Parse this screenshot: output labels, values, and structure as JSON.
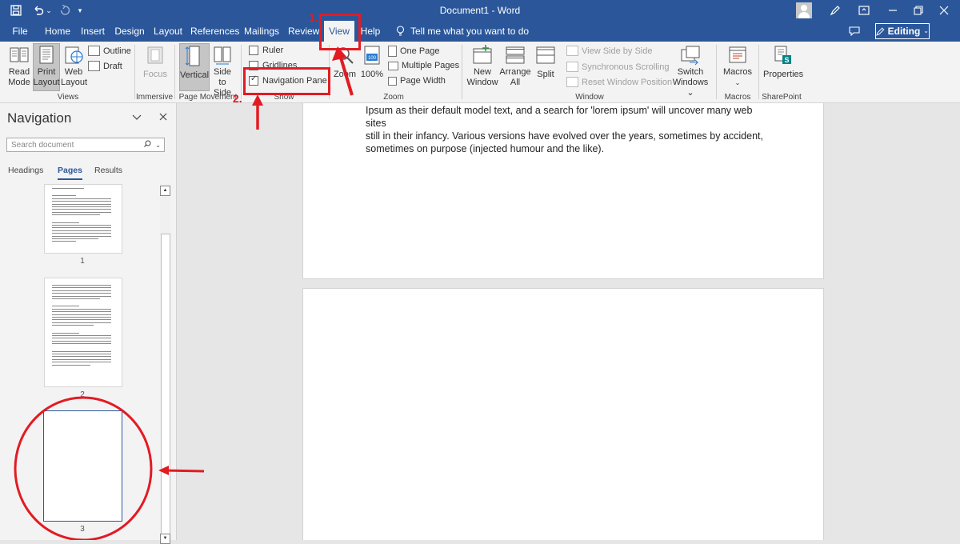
{
  "window": {
    "title": "Document1  -  Word"
  },
  "ribbon_tabs": [
    "File",
    "Home",
    "Insert",
    "Design",
    "Layout",
    "References",
    "Mailings",
    "Review",
    "View",
    "Help"
  ],
  "active_tab": "View",
  "tell_me": "Tell me what you want to do",
  "editing_label": "Editing",
  "ribbon": {
    "views": {
      "label": "Views",
      "read_mode": [
        "Read",
        "Mode"
      ],
      "print_layout": [
        "Print",
        "Layout"
      ],
      "web_layout": [
        "Web",
        "Layout"
      ],
      "outline": "Outline",
      "draft": "Draft"
    },
    "immersive": {
      "label": "Immersive",
      "focus": "Focus"
    },
    "page_movement": {
      "label": "Page Movement",
      "vertical": "Vertical",
      "side_to_side": [
        "Side",
        "to Side"
      ]
    },
    "show": {
      "label": "Show",
      "ruler": "Ruler",
      "gridlines": "Gridlines",
      "navigation_pane": "Navigation Pane",
      "ruler_checked": false,
      "gridlines_checked": false,
      "navigation_pane_checked": true
    },
    "zoom": {
      "label": "Zoom",
      "zoom": "Zoom",
      "hundred": "100%",
      "one_page": "One Page",
      "multiple_pages": "Multiple Pages",
      "page_width": "Page Width"
    },
    "window": {
      "label": "Window",
      "new_window": [
        "New",
        "Window"
      ],
      "arrange_all": [
        "Arrange",
        "All"
      ],
      "split": "Split",
      "view_side_by_side": "View Side by Side",
      "synchronous_scrolling": "Synchronous Scrolling",
      "reset_window_position": "Reset Window Position",
      "switch_windows": [
        "Switch",
        "Windows ⌄"
      ]
    },
    "macros": {
      "label": "Macros",
      "macros": "Macros"
    },
    "sharepoint": {
      "label": "SharePoint",
      "properties": "Properties"
    }
  },
  "navigation": {
    "title": "Navigation",
    "search_placeholder": "Search document",
    "tabs": [
      "Headings",
      "Pages",
      "Results"
    ],
    "active_tab": "Pages",
    "pages": [
      "1",
      "2",
      "3"
    ]
  },
  "document": {
    "lines": [
      "Ipsum as their default model text, and a search for 'lorem ipsum' will uncover many web sites",
      "still in their infancy. Various versions have evolved over the years, sometimes by accident,",
      "sometimes on purpose (injected humour and the like)."
    ]
  },
  "annotations": {
    "step1": "1.",
    "step2": "2."
  },
  "colors": {
    "word_blue": "#2b579a",
    "annotation_red": "#e21b23",
    "ribbon_bg": "#f3f3f3"
  }
}
